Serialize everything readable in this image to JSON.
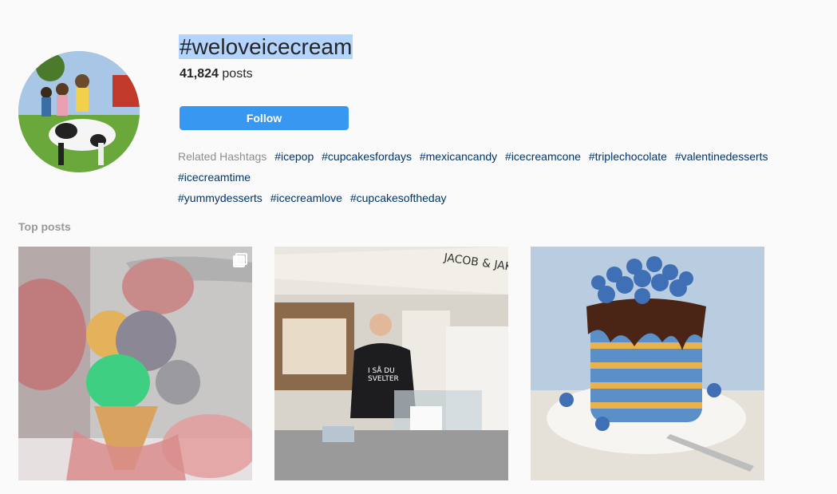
{
  "hashtag": {
    "title": "#weloveicecream",
    "post_count": "41,824",
    "post_suffix": "posts"
  },
  "actions": {
    "follow_label": "Follow"
  },
  "related": {
    "label": "Related Hashtags",
    "tags": [
      "#icepop",
      "#cupcakesfordays",
      "#mexicancandy",
      "#icecreamcone",
      "#triplechocolate",
      "#valentinedesserts",
      "#icecreamtime",
      "#yummydesserts",
      "#icecreamlove",
      "#cupcakesoftheday"
    ]
  },
  "top_posts": {
    "label": "Top posts",
    "items": [
      {
        "sign_line1": "JACOB & JAKOB ICE",
        "shirt_line1": "I SÅ DU",
        "shirt_line2": "SVELTER"
      }
    ]
  },
  "colors": {
    "link": "#003569",
    "button": "#3897f0",
    "selection": "#b3d4fc"
  }
}
